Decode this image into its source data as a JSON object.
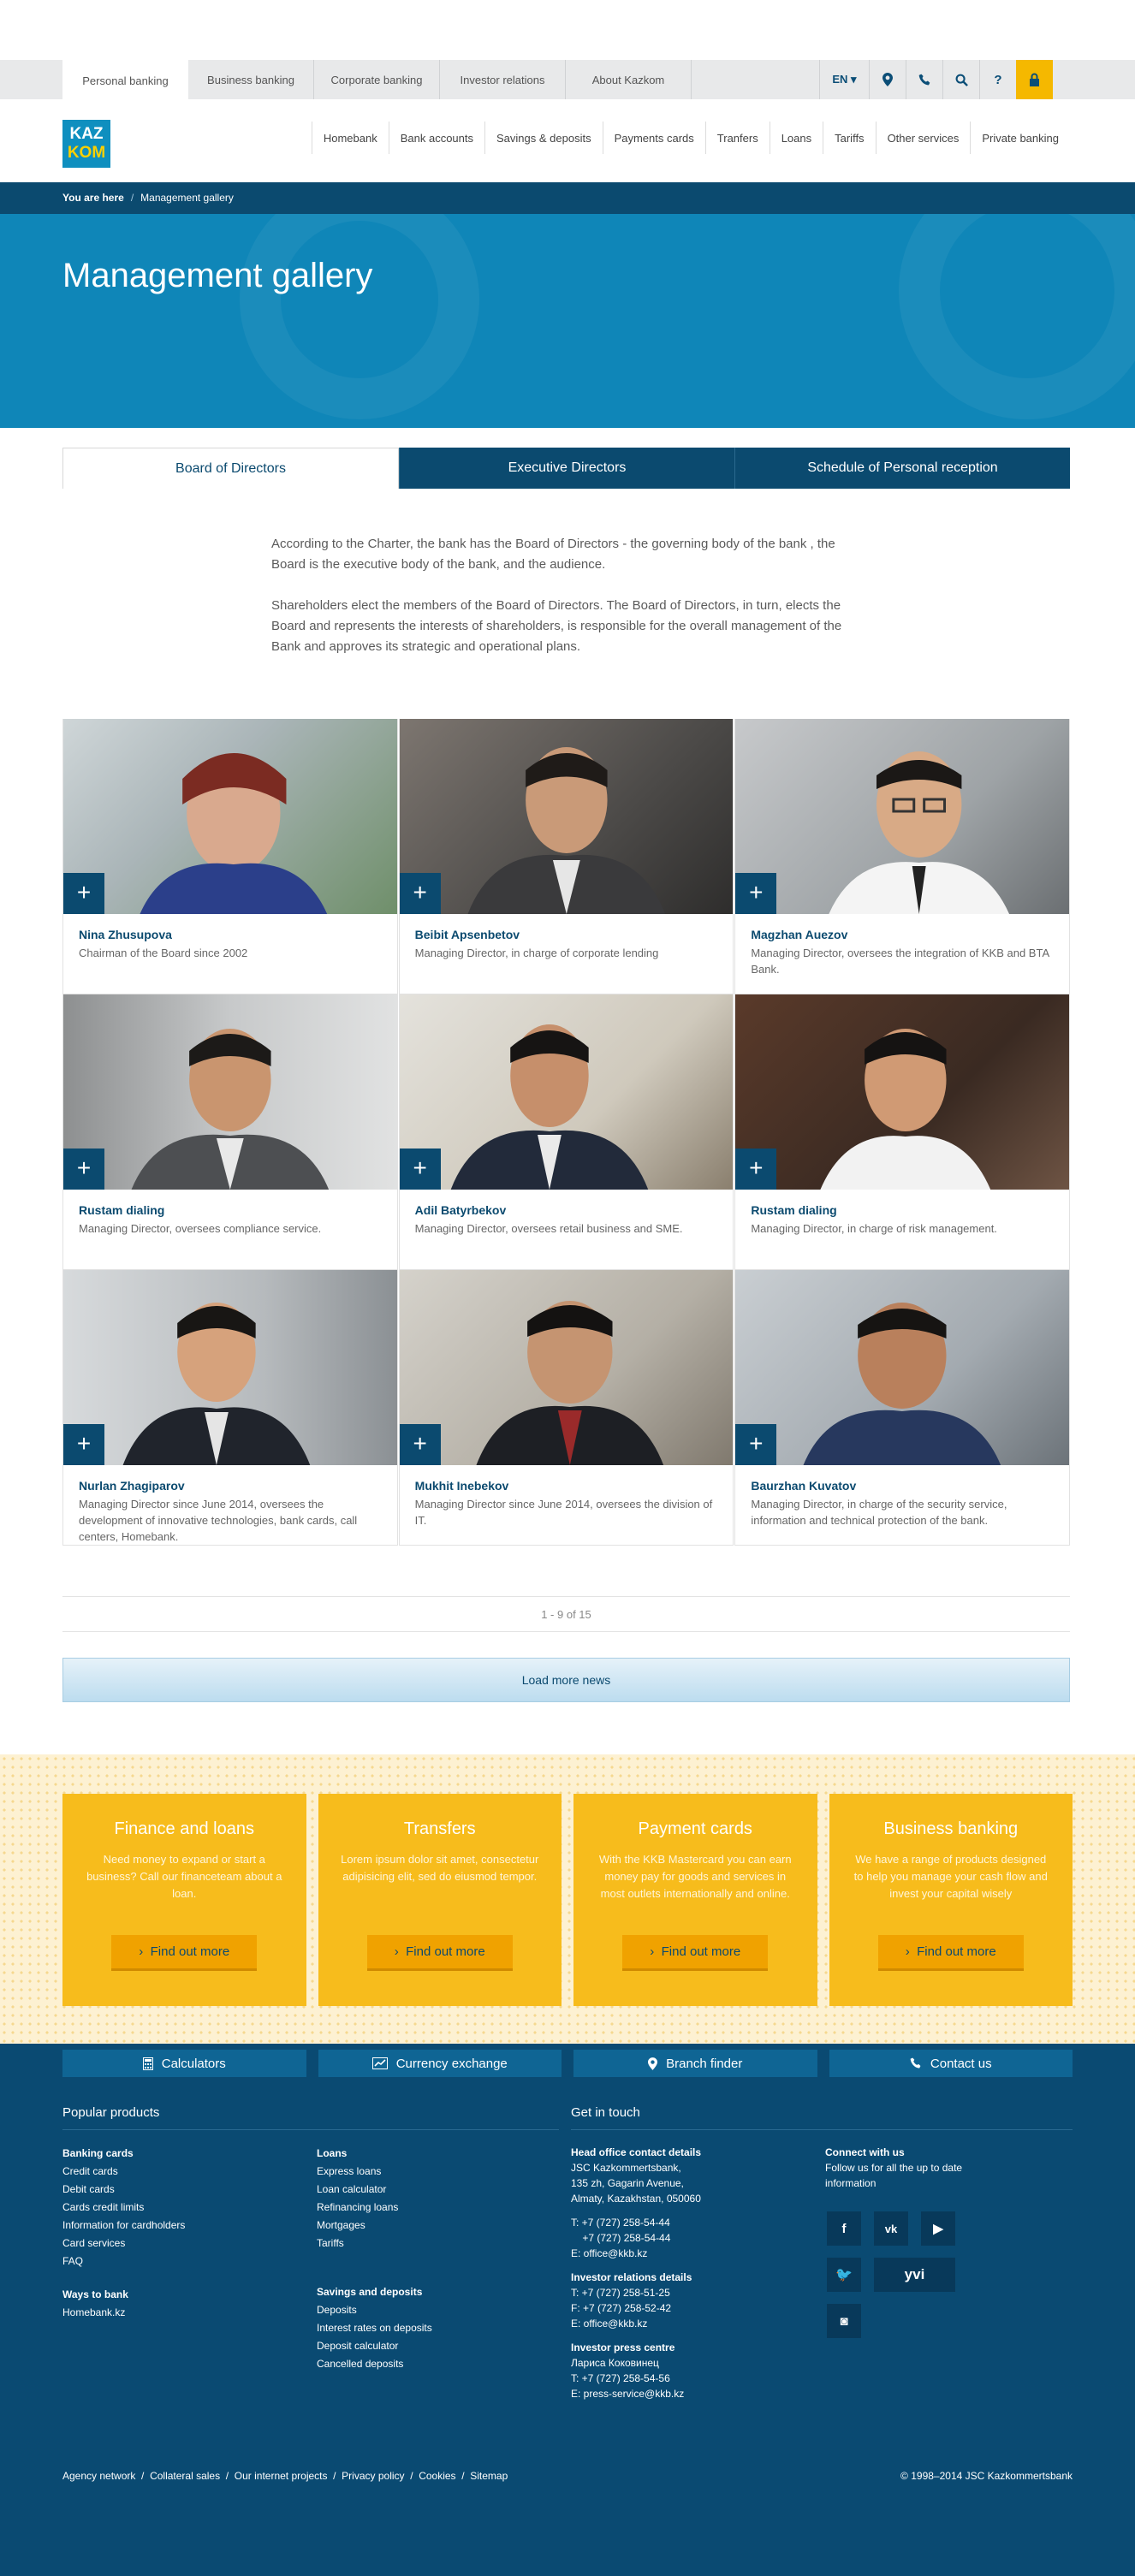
{
  "top_tabs": [
    "Personal banking",
    "Business banking",
    "Corporate banking",
    "Investor relations",
    "About Kazkom"
  ],
  "top_icons": {
    "lang": "EN ▾",
    "icons": [
      "location-pin-icon",
      "phone-icon",
      "search-icon",
      "help-icon",
      "lock-icon"
    ]
  },
  "logo": {
    "line1": "KAZ",
    "line2": "KOM"
  },
  "main_nav": [
    "Homebank",
    "Bank accounts",
    "Savings & deposits",
    "Payments cards",
    "Tranfers",
    "Loans",
    "Tariffs",
    "Other services",
    "Private banking"
  ],
  "breadcrumb": {
    "label": "You are here",
    "sep": "/",
    "current": "Management gallery"
  },
  "hero": {
    "title": "Management gallery"
  },
  "sub_tabs": [
    "Board of Directors",
    "Executive Directors",
    "Schedule of Personal reception"
  ],
  "intro": [
    "According to the Charter, the bank has the Board of Directors - the governing body of the bank , the Board is the executive body of the bank, and the audience.",
    "Shareholders elect the members of the Board of Directors. The Board of Directors, in turn, elects the Board and represents the interests of shareholders, is responsible for the overall management of the Bank and approves its strategic and operational plans."
  ],
  "people": [
    {
      "name": "Nina Zhusupova",
      "role": "Chairman of the Board since 2002"
    },
    {
      "name": "Beibit Apsenbetov",
      "role": "Managing Director, in charge of corporate lending"
    },
    {
      "name": "Magzhan Auezov",
      "role": "Managing Director, oversees the integration of KKB and BTA Bank."
    },
    {
      "name": "Rustam dialing",
      "role": "Managing Director, oversees compliance service."
    },
    {
      "name": "Adil Batyrbekov",
      "role": "Managing Director, oversees retail business and SME."
    },
    {
      "name": "Rustam dialing",
      "role": "Managing Director, in charge of risk management."
    },
    {
      "name": "Nurlan Zhagiparov",
      "role": "Managing Director since June 2014, oversees the development of innovative technologies, bank cards, call centers, Homebank."
    },
    {
      "name": "Mukhit Inebekov",
      "role": "Managing Director since June 2014, oversees the division of IT."
    },
    {
      "name": "Baurzhan Kuvatov",
      "role": " Managing Director, in charge of the security service, information and technical protection of the bank."
    }
  ],
  "plus_symbol": "+",
  "pager": "1 - 9 of 15",
  "load_more": "Load more news",
  "promos": [
    {
      "title": "Finance and loans",
      "text": "Need money to expand or start a business? Call our financeteam about a loan.",
      "button": "Find out more"
    },
    {
      "title": "Transfers",
      "text": "Lorem ipsum dolor sit amet, consectetur adipisicing elit, sed do eiusmod tempor.",
      "button": "Find out more"
    },
    {
      "title": "Payment cards",
      "text": "With the KKB Mastercard you can earn money pay for goods and services in most outlets internationally and online.",
      "button": "Find out more"
    },
    {
      "title": "Business banking",
      "text": "We have a range of products designed to help you manage your cash flow and invest your capital wisely",
      "button": "Find out more"
    }
  ],
  "footer_buttons": [
    {
      "label": "Calculators",
      "icon": "calculator-icon"
    },
    {
      "label": "Currency exchange",
      "icon": "chart-icon"
    },
    {
      "label": "Branch finder",
      "icon": "location-pin-icon"
    },
    {
      "label": "Contact us",
      "icon": "phone-icon"
    }
  ],
  "footer": {
    "popular_title": "Popular products",
    "contact_title": "Get in touch",
    "col1": {
      "h1": "Banking cards",
      "items1": [
        "Credit cards",
        "Debit cards",
        "Cards credit limits",
        "Information for cardholders",
        "Card services",
        "FAQ"
      ],
      "h2": "Ways to bank",
      "items2": [
        "Homebank.kz"
      ]
    },
    "col2": {
      "h1": "Loans",
      "items1": [
        "Express loans",
        "Loan calculator",
        "Refinancing loans",
        "Mortgages",
        "Tariffs"
      ],
      "h2": "Savings and deposits",
      "items2": [
        "Deposits",
        "Interest rates on deposits",
        "Deposit calculator",
        "Cancelled deposits"
      ]
    },
    "col3": {
      "h1": "Head office contact details",
      "addr": [
        "JSC Kazkommertsbank,",
        "135 zh, Gagarin Avenue,",
        "Almaty, Kazakhstan, 050060"
      ],
      "phones1": [
        "T: +7 (727) 258-54-44",
        "    +7 (727) 258-54-44",
        "E: office@kkb.kz"
      ],
      "h2": "Investor relations details",
      "phones2": [
        "T: +7 (727) 258-51-25",
        "F: +7 (727) 258-52-42",
        "E: office@kkb.kz"
      ],
      "h3": "Investor press centre",
      "phones3": [
        "Лариса Коковинец",
        "T: +7 (727) 258-54-56",
        "E: press-service@kkb.kz"
      ]
    },
    "col4": {
      "h1": "Connect with us",
      "text": "Follow us for all the up to date information"
    },
    "social": [
      "f",
      "vk",
      "▶",
      "🐦",
      "yvi",
      "◙"
    ],
    "bottom_links": [
      "Agency network",
      "Collateral sales",
      "Our internet projects",
      "Privacy policy",
      "Cookies",
      "Sitemap"
    ],
    "copyright": "© 1998–2014 JSC Kazkommertsbank"
  }
}
